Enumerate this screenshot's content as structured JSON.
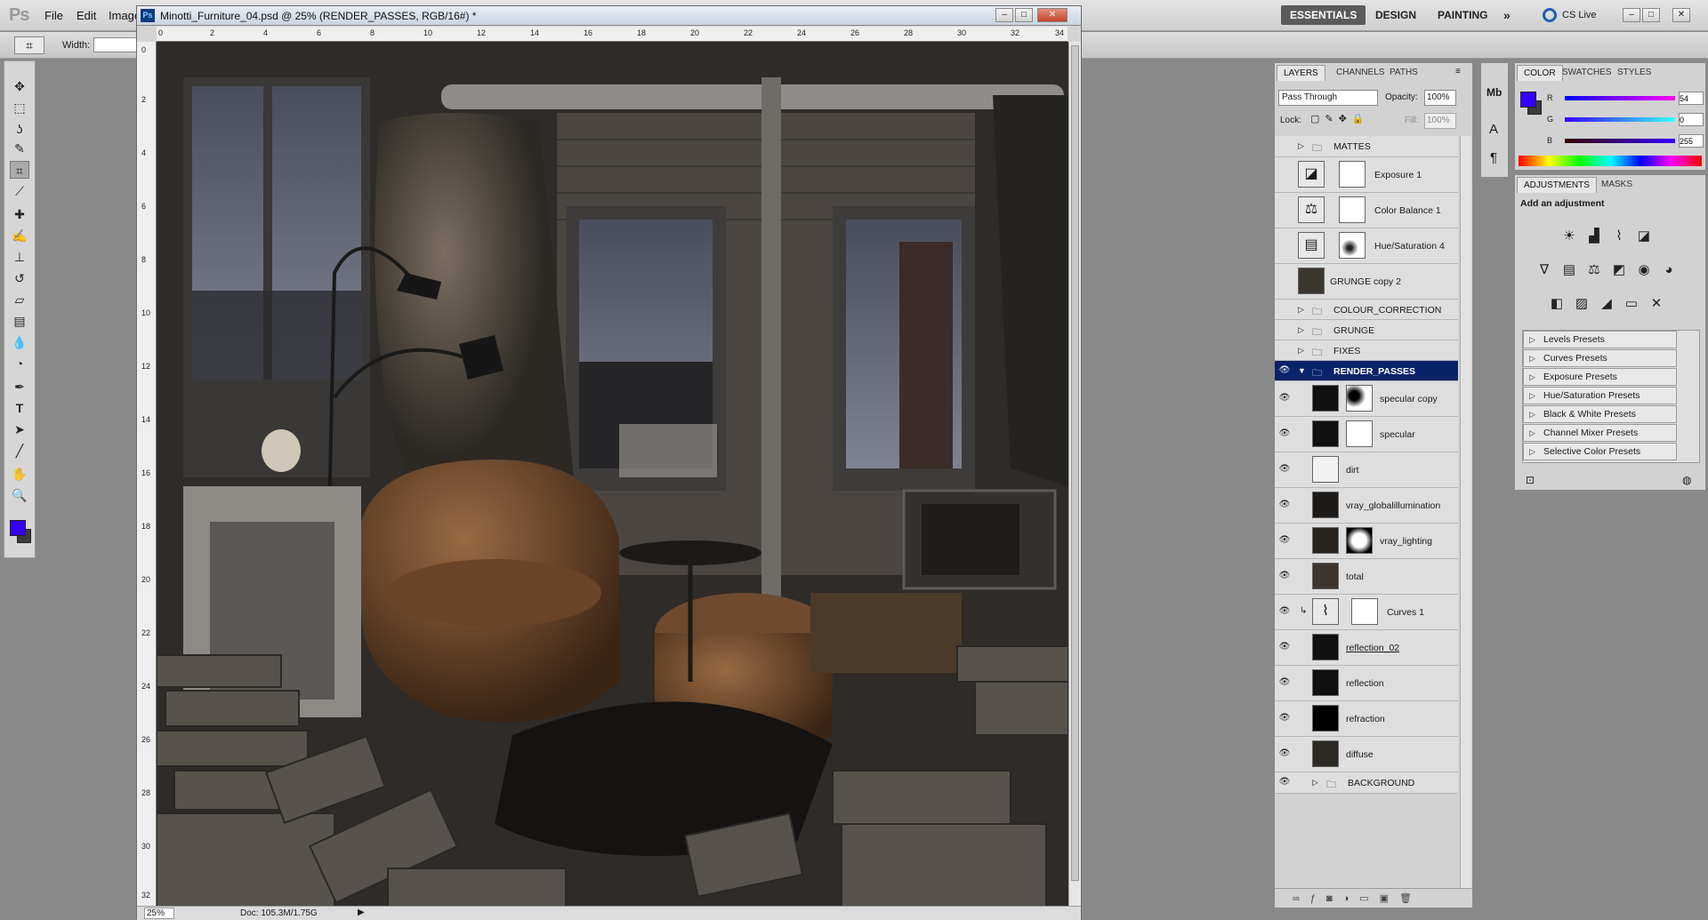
{
  "app": {
    "logo": "Ps",
    "menus": [
      "File",
      "Edit",
      "Image"
    ],
    "workspaces": [
      "ESSENTIALS",
      "DESIGN",
      "PAINTING"
    ],
    "workspace_more": "»",
    "cs_live": "CS Live"
  },
  "options_bar": {
    "width_label": "Width:",
    "width_value": ""
  },
  "document": {
    "ps_badge": "Ps",
    "title": "Minotti_Furniture_04.psd @ 25% (RENDER_PASSES, RGB/16#) *",
    "ruler_top_ticks": [
      "0",
      "2",
      "4",
      "6",
      "8",
      "10",
      "12",
      "14",
      "16",
      "18",
      "20",
      "22",
      "24",
      "26",
      "28",
      "30",
      "32",
      "34"
    ],
    "ruler_left_ticks": [
      "0",
      "2",
      "4",
      "6",
      "8",
      "10",
      "12",
      "14",
      "16",
      "18",
      "20",
      "22",
      "24",
      "26",
      "28",
      "30",
      "32"
    ],
    "zoom": "25%",
    "doc_size": "Doc: 105.3M/1.75G"
  },
  "layers_panel": {
    "tabs": [
      "LAYERS",
      "CHANNELS",
      "PATHS"
    ],
    "blend_mode": "Pass Through",
    "opacity_label": "Opacity:",
    "opacity_value": "100%",
    "lock_label": "Lock:",
    "fill_label": "Fill:",
    "fill_value": "100%",
    "layers": [
      {
        "name": "MATTES",
        "type": "group",
        "visible": false
      },
      {
        "name": "Exposure 1",
        "type": "adjustment",
        "visible": false
      },
      {
        "name": "Color Balance 1",
        "type": "adjustment",
        "visible": false
      },
      {
        "name": "Hue/Saturation 4",
        "type": "adjustment",
        "visible": false
      },
      {
        "name": "GRUNGE copy 2",
        "type": "image",
        "visible": false
      },
      {
        "name": "COLOUR_CORRECTION",
        "type": "group",
        "visible": false
      },
      {
        "name": "GRUNGE",
        "type": "group",
        "visible": false
      },
      {
        "name": "FIXES",
        "type": "group",
        "visible": false
      },
      {
        "name": "RENDER_PASSES",
        "type": "group-open",
        "visible": true
      },
      {
        "name": "specular copy",
        "type": "image-mask",
        "visible": true
      },
      {
        "name": "specular",
        "type": "image-mask",
        "visible": true
      },
      {
        "name": "dirt",
        "type": "image-light",
        "visible": true
      },
      {
        "name": "vray_globalillumination",
        "type": "image",
        "visible": true
      },
      {
        "name": "vray_lighting",
        "type": "image-mask-radial",
        "visible": true
      },
      {
        "name": "total",
        "type": "image",
        "visible": true
      },
      {
        "name": "Curves 1",
        "type": "adjustment-clip",
        "visible": true
      },
      {
        "name": "reflection_02",
        "type": "image",
        "visible": true
      },
      {
        "name": "reflection",
        "type": "image",
        "visible": true
      },
      {
        "name": "refraction",
        "type": "image",
        "visible": true
      },
      {
        "name": "diffuse",
        "type": "image",
        "visible": true
      },
      {
        "name": "BACKGROUND",
        "type": "group-nested",
        "visible": true
      }
    ]
  },
  "color_panel": {
    "tabs": [
      "COLOR",
      "SWATCHES",
      "STYLES"
    ],
    "r_label": "R",
    "r_value": "54",
    "g_label": "G",
    "g_value": "0",
    "b_label": "B",
    "b_value": "255",
    "foreground": "#3600ff"
  },
  "adjustments_panel": {
    "tabs": [
      "ADJUSTMENTS",
      "MASKS"
    ],
    "heading": "Add an adjustment",
    "presets": [
      "Levels Presets",
      "Curves Presets",
      "Exposure Presets",
      "Hue/Saturation Presets",
      "Black & White Presets",
      "Channel Mixer Presets",
      "Selective Color Presets"
    ]
  },
  "icons": {
    "tools": [
      "move-tool-icon",
      "marquee-tool-icon",
      "lasso-tool-icon",
      "quick-select-tool-icon",
      "crop-tool-icon",
      "eyedropper-tool-icon",
      "healing-brush-icon",
      "brush-tool-icon",
      "clone-stamp-icon",
      "history-brush-icon",
      "eraser-tool-icon",
      "gradient-tool-icon",
      "blur-tool-icon",
      "dodge-tool-icon",
      "pen-tool-icon",
      "type-tool-icon",
      "path-select-icon",
      "shape-tool-icon",
      "hand-tool-icon",
      "zoom-tool-icon"
    ]
  }
}
